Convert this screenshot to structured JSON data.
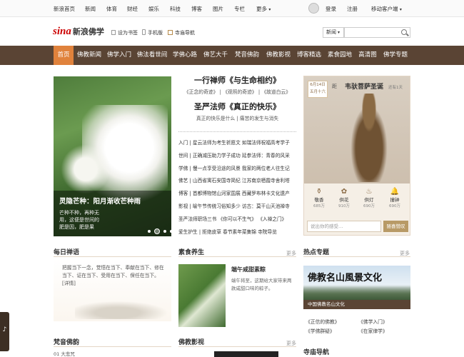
{
  "topbar": {
    "links": [
      "新浪首页",
      "新闻",
      "体育",
      "财经",
      "娱乐",
      "科技",
      "博客",
      "图片",
      "专栏",
      "更多"
    ],
    "login": "登录",
    "register": "注册",
    "mobile": "移动客户端"
  },
  "header": {
    "logo_mark": "sina",
    "logo_text": "新浪佛学",
    "links": [
      "设为书签",
      "手机版",
      "寺庙导航"
    ],
    "search_select": "新闻",
    "search_placeholder": ""
  },
  "nav": [
    "首页",
    "佛教新闻",
    "佛学入门",
    "佛法看世间",
    "学佛心路",
    "佛艺大千",
    "梵音佛韵",
    "佛教影视",
    "博客精选",
    "素食园地",
    "高清图",
    "佛学专题"
  ],
  "slide": {
    "title": "灵隐芒种：阳月渐收芒种雨",
    "caption": "芒种不种，再种无用，这便是世间的肥是因，肥是果"
  },
  "headlines": {
    "h1": "一行禅师《与生命相约》",
    "h1_links": [
      "《正念的奇迹》",
      "《观照的奇迹》",
      "《故道白云》"
    ],
    "h2": "圣严法师《真正的快乐》",
    "h2_sub": "真正的快乐是什么 | 痛苦的发生与消失"
  },
  "news": [
    "入门 | 星云法师为考生祈愿文  如瑞法师祝福高考学子",
    "世间 | 正确减压助力学子成功  延参法师：青春的风采",
    "学佛 | 慢一点享受沿途的风景  我家的两位老人往生记",
    "佛艺 | 山西省寓石安国寺简纪  江苏南京栖霞寺舍利塔",
    "博客 | 首都博物馆山河家国展  西藏罗布林卡文化遗产",
    "影视 | 喻午节传统习俗知多少  访古：莫干山天池禅寺",
    "圣严法师职场三书  《你可以不生气》  《入禅之门》",
    "爱生护生 | 拒绝皮草  春节素年菜集锦  寺院导览"
  ],
  "deity": {
    "date": "6月14日",
    "lunar": "五月十六",
    "title": "韦驮菩萨圣诞",
    "note": "还有1天",
    "prefix": "距",
    "actions": [
      {
        "label": "敬香",
        "count": "685万"
      },
      {
        "label": "供花",
        "count": "910万"
      },
      {
        "label": "供灯",
        "count": "690万"
      },
      {
        "label": "撞钟",
        "count": "690万"
      }
    ],
    "wish_placeholder": "说出你的感受…",
    "wish_btn": "随喜赞叹"
  },
  "daily": {
    "title": "每日禅语",
    "text": "把握当下一念，觉悟在当下、奉献在当下、修在当下、证在当下、受用在当下、保任在当下。[详情]"
  },
  "veg": {
    "title": "素食养生",
    "more": "更多",
    "dish": "端午咸甜素粽",
    "desc": "端午将至，这期给大家带来两款咸甜口味的粽子。"
  },
  "topic": {
    "title": "热点专题",
    "more": "更多",
    "banner": "佛教名山風景文化",
    "banner_sub": "中国佛教名山文化",
    "links": [
      "《正信的佛教》",
      "《佛学入门》",
      "《学佛群疑》",
      "《在家律学》"
    ]
  },
  "music": {
    "title": "梵音佛韵",
    "row": "大悲咒"
  },
  "film": {
    "title": "佛教影视",
    "more": "更多"
  },
  "temple": {
    "title": "寺庙导航"
  },
  "colors": {
    "nav_bg": "#5a4434",
    "nav_active": "#e0823c",
    "brown": "#8a6a44",
    "btn": "#b89a66"
  }
}
